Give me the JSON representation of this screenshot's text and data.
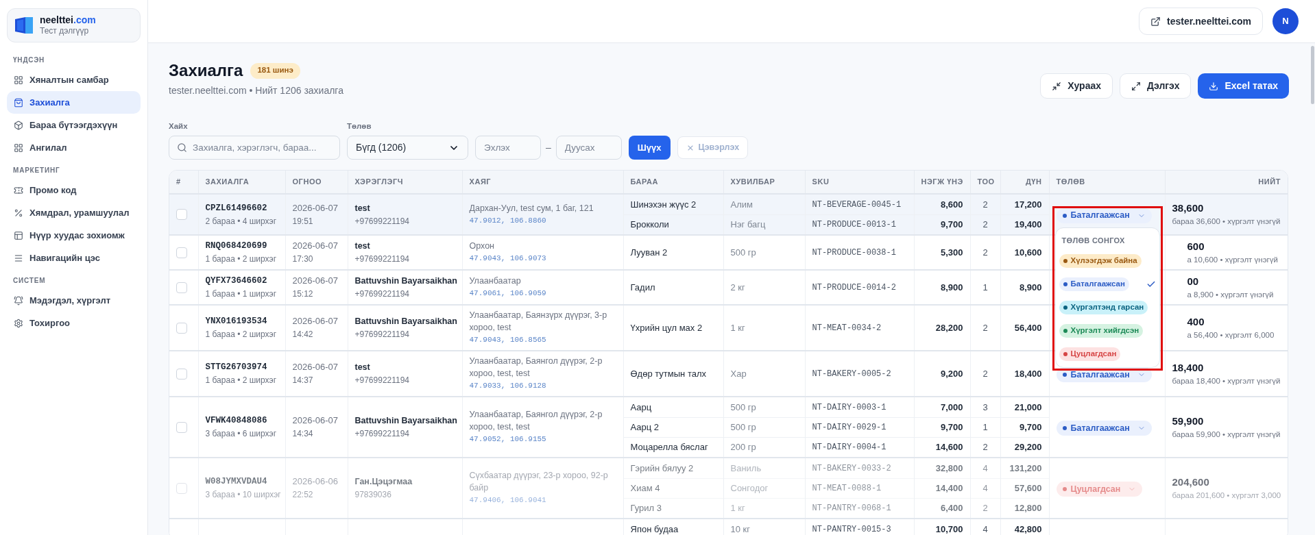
{
  "brand": {
    "name": "neelttei",
    "suffix": ".com",
    "subtitle": "Тест дэлгүүр"
  },
  "sidebar": [
    {
      "title": "ҮНДСЭН",
      "items": [
        {
          "label": "Хяналтын самбар",
          "selected": false
        },
        {
          "label": "Захиалга",
          "selected": true
        },
        {
          "label": "Бараа бүтээгдэхүүн",
          "selected": false
        },
        {
          "label": "Ангилал",
          "selected": false
        }
      ]
    },
    {
      "title": "МАРКЕТИНГ",
      "items": [
        {
          "label": "Промо код",
          "selected": false
        },
        {
          "label": "Хямдрал, урамшуулал",
          "selected": false
        },
        {
          "label": "Нүүр хуудас зохиомж",
          "selected": false
        },
        {
          "label": "Навигацийн цэс",
          "selected": false
        }
      ]
    },
    {
      "title": "СИСТЕМ",
      "items": [
        {
          "label": "Мэдэгдэл, хүргэлт",
          "selected": false
        },
        {
          "label": "Тохиргоо",
          "selected": false
        }
      ]
    }
  ],
  "header": {
    "site_link": "tester.neelttei.com",
    "avatar": "N"
  },
  "page": {
    "title": "Захиалга",
    "badge": "181 шинэ",
    "subtitle": "tester.neelttei.com • Нийт 1206 захиалга",
    "actions": [
      {
        "label": "Хураах",
        "kind": "secondary"
      },
      {
        "label": "Дэлгэх",
        "kind": "secondary"
      },
      {
        "label": "Excel татах",
        "kind": "primary"
      }
    ]
  },
  "filters": {
    "search": {
      "label": "Хайх",
      "placeholder": "Захиалга, хэрэглэгч, бараа..."
    },
    "status": {
      "label": "Төлөв",
      "value": "Бүгд (1206)"
    },
    "date_from": {
      "placeholder": "Эхлэх"
    },
    "range_separator": "–",
    "date_to": {
      "placeholder": "Дуусах"
    },
    "apply": "Шүүх",
    "clear": {
      "label": "Цэвэрлэх",
      "disabled": true
    }
  },
  "table": {
    "columns": [
      "#",
      "ЗАХИАЛГА",
      "ОГНОО",
      "ХЭРЭГЛЭГЧ",
      "ХАЯГ",
      "БАРАА",
      "ХУВИЛБАР",
      "SKU",
      "НЭГЖ ҮНЭ",
      "ТОО",
      "ДҮН",
      "ТӨЛӨВ",
      "НИЙТ"
    ],
    "orders": [
      {
        "highlighted": true,
        "checked": false,
        "id": "CPZL61496602",
        "summary": "2 бараа • 4 ширхэг",
        "date": "2026-06-07",
        "time": "19:51",
        "customer": "test",
        "phone": "+97699221194",
        "address": "Дархан-Уул, test сум, 1 баг, 121",
        "coords": "47.9012, 106.8860",
        "items": [
          {
            "name": "Шинэхэн жүүс 2",
            "variant": "Алим",
            "sku": "NT-BEVERAGE-0045-1",
            "price": "8,600",
            "qty": "2",
            "sum": "17,200"
          },
          {
            "name": "Брокколи",
            "variant": "Нэг багц",
            "sku": "NT-PRODUCE-0013-1",
            "price": "9,700",
            "qty": "2",
            "sum": "19,400"
          }
        ],
        "status": {
          "label": "Баталгаажсан",
          "kind": "confirmed",
          "menu_open": true
        },
        "total": "38,600",
        "total_note": "бараа 36,600 • хүргэлт үнэгүй"
      },
      {
        "highlighted": false,
        "checked": false,
        "id": "RNQ068420699",
        "summary": "1 бараа • 2 ширхэг",
        "date": "2026-06-07",
        "time": "17:30",
        "customer": "test",
        "phone": "+97699221194",
        "address": "Орхон",
        "coords": "47.9043, 106.9073",
        "items": [
          {
            "name": "Лууван 2",
            "variant": "500 гр",
            "sku": "NT-PRODUCE-0038-1",
            "price": "5,300",
            "qty": "2",
            "sum": "10,600"
          }
        ],
        "total": "600",
        "total_note": "а 10,600 • хүргэлт үнэгүй"
      },
      {
        "highlighted": false,
        "checked": false,
        "id": "QYFX73646602",
        "summary": "1 бараа • 1 ширхэг",
        "date": "2026-06-07",
        "time": "15:12",
        "customer": "Battuvshin Bayarsaikhan",
        "phone": "+97699221194",
        "address": "Улаанбаатар",
        "coords": "47.9061, 106.9059",
        "items": [
          {
            "name": "Гадил",
            "variant": "2 кг",
            "sku": "NT-PRODUCE-0014-2",
            "price": "8,900",
            "qty": "1",
            "sum": "8,900"
          }
        ],
        "total": "00",
        "total_note": "а 8,900 • хүргэлт үнэгүй"
      },
      {
        "highlighted": false,
        "checked": false,
        "id": "YNX016193534",
        "summary": "1 бараа • 2 ширхэг",
        "date": "2026-06-07",
        "time": "14:42",
        "customer": "Battuvshin Bayarsaikhan",
        "phone": "+97699221194",
        "address": "Улаанбаатар, Баянзүрх дүүрэг, 3-р хороо, test",
        "coords": "47.9043, 106.8565",
        "items": [
          {
            "name": "Үхрийн цул мах 2",
            "variant": "1 кг",
            "sku": "NT-MEAT-0034-2",
            "price": "28,200",
            "qty": "2",
            "sum": "56,400"
          }
        ],
        "total": "400",
        "total_note": "а 56,400 • хүргэлт 6,000"
      },
      {
        "highlighted": false,
        "checked": false,
        "id": "STTG26703974",
        "summary": "1 бараа • 2 ширхэг",
        "date": "2026-06-07",
        "time": "14:37",
        "customer": "test",
        "phone": "+97699221194",
        "address": "Улаанбаатар, Баянгол дүүрэг, 2-р хороо, test, test",
        "coords": "47.9033, 106.9128",
        "items": [
          {
            "name": "Өдөр тутмын талх",
            "variant": "Хар",
            "sku": "NT-BAKERY-0005-2",
            "price": "9,200",
            "qty": "2",
            "sum": "18,400"
          }
        ],
        "status": {
          "label": "Баталгаажсан",
          "kind": "confirmed",
          "menu_open": false
        },
        "total": "18,400",
        "total_note": "бараа 18,400 • хүргэлт үнэгүй"
      },
      {
        "highlighted": false,
        "checked": false,
        "id": "VFWK40848086",
        "summary": "3 бараа • 6 ширхэг",
        "date": "2026-06-07",
        "time": "14:34",
        "customer": "Battuvshin Bayarsaikhan",
        "phone": "+97699221194",
        "address": "Улаанбаатар, Баянгол дүүрэг, 2-р хороо, test, test",
        "coords": "47.9052, 106.9155",
        "items": [
          {
            "name": "Аарц",
            "variant": "500 гр",
            "sku": "NT-DAIRY-0003-1",
            "price": "7,000",
            "qty": "3",
            "sum": "21,000"
          },
          {
            "name": "Аарц 2",
            "variant": "500 гр",
            "sku": "NT-DAIRY-0029-1",
            "price": "9,700",
            "qty": "1",
            "sum": "9,700"
          },
          {
            "name": "Моцарелла бяслаг",
            "variant": "200 гр",
            "sku": "NT-DAIRY-0004-1",
            "price": "14,600",
            "qty": "2",
            "sum": "29,200"
          }
        ],
        "status": {
          "label": "Баталгаажсан",
          "kind": "confirmed",
          "menu_open": false
        },
        "total": "59,900",
        "total_note": "бараа 59,900 • хүргэлт үнэгүй"
      },
      {
        "highlighted": false,
        "checked": false,
        "id": "W08JYMXVDAU4",
        "summary": "3 бараа • 10 ширхэг",
        "date": "2026-06-06",
        "time": "22:52",
        "customer": "Ган.Цэцэгмаа",
        "phone": "97839036",
        "address": "Сүхбаатар дүүрэг, 23-р хороо, 92-р байр",
        "coords": "47.9406, 106.9041",
        "items": [
          {
            "name": "Гэрийн бялуу 2",
            "variant": "Ваниль",
            "sku": "NT-BAKERY-0033-2",
            "price": "32,800",
            "qty": "4",
            "sum": "131,200"
          },
          {
            "name": "Хиам 4",
            "variant": "Сонгодог",
            "sku": "NT-MEAT-0088-1",
            "price": "14,400",
            "qty": "4",
            "sum": "57,600"
          },
          {
            "name": "Гурил 3",
            "variant": "1 кг",
            "sku": "NT-PANTRY-0068-1",
            "price": "6,400",
            "qty": "2",
            "sum": "12,800"
          }
        ],
        "status": {
          "label": "Цуцлагдсан",
          "kind": "cancelled",
          "menu_open": false
        },
        "total": "204,600",
        "total_note": "бараа 201,600 • хүргэлт 3,000"
      },
      {
        "highlighted": false,
        "items": [
          {
            "name": "Япон будаа",
            "variant": "10 кг",
            "sku": "NT-PANTRY-0015-3",
            "price": "10,700",
            "qty": "4",
            "sum": "42,800"
          }
        ]
      }
    ]
  },
  "status_menu": {
    "title": "ТӨЛӨВ СОНГОХ",
    "options": [
      {
        "label": "Хүлээгдэж байна",
        "kind": "pending",
        "selected": false
      },
      {
        "label": "Баталгаажсан",
        "kind": "confirmed",
        "selected": true
      },
      {
        "label": "Хүргэлтэнд гарсан",
        "kind": "shipping",
        "selected": false
      },
      {
        "label": "Хүргэлт хийгдсэн",
        "kind": "delivered",
        "selected": false
      },
      {
        "label": "Цуцлагдсан",
        "kind": "cancelled",
        "selected": false
      }
    ]
  }
}
